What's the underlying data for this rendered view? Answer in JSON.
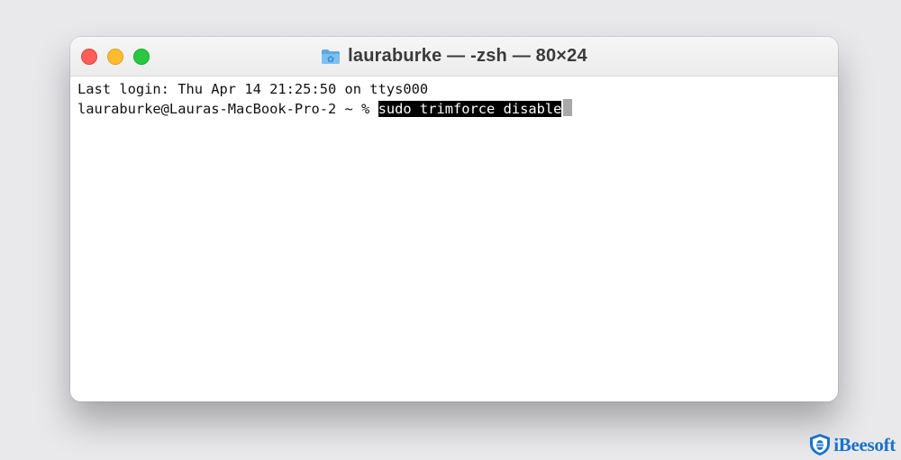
{
  "window": {
    "title": "lauraburke — -zsh — 80×24"
  },
  "terminal": {
    "lines": [
      "Last login: Thu Apr 14 21:25:50 on ttys000"
    ],
    "prompt": "lauraburke@Lauras-MacBook-Pro-2 ~ % ",
    "command": "sudo trimforce disable"
  },
  "watermark": {
    "text": "iBeesoft"
  },
  "colors": {
    "close": "#ff5f57",
    "minimize": "#febc2e",
    "zoom": "#28c840",
    "folder": "#5aa9e6",
    "watermark": "#1a73c9"
  },
  "icons": {
    "title": "folder-home-icon",
    "watermark": "bee-shield-icon"
  }
}
